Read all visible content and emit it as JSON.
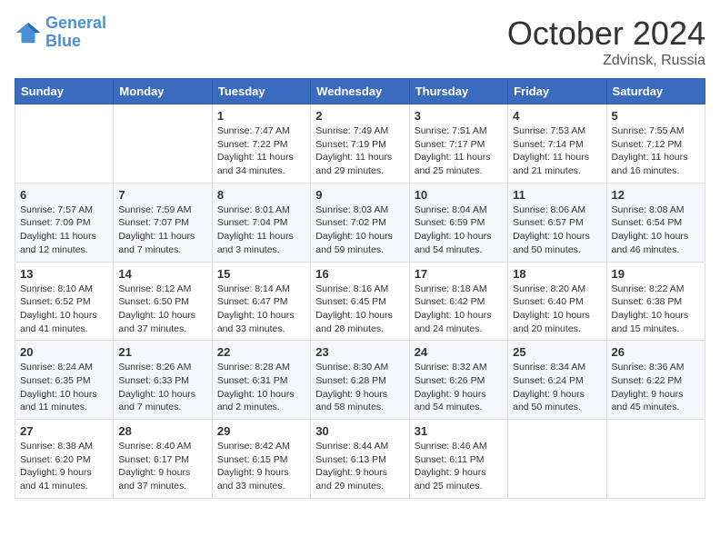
{
  "header": {
    "logo_line1": "General",
    "logo_line2": "Blue",
    "month": "October 2024",
    "location": "Zdvinsk, Russia"
  },
  "days_of_week": [
    "Sunday",
    "Monday",
    "Tuesday",
    "Wednesday",
    "Thursday",
    "Friday",
    "Saturday"
  ],
  "weeks": [
    [
      {
        "day": "",
        "info": ""
      },
      {
        "day": "",
        "info": ""
      },
      {
        "day": "1",
        "info": "Sunrise: 7:47 AM\nSunset: 7:22 PM\nDaylight: 11 hours and 34 minutes."
      },
      {
        "day": "2",
        "info": "Sunrise: 7:49 AM\nSunset: 7:19 PM\nDaylight: 11 hours and 29 minutes."
      },
      {
        "day": "3",
        "info": "Sunrise: 7:51 AM\nSunset: 7:17 PM\nDaylight: 11 hours and 25 minutes."
      },
      {
        "day": "4",
        "info": "Sunrise: 7:53 AM\nSunset: 7:14 PM\nDaylight: 11 hours and 21 minutes."
      },
      {
        "day": "5",
        "info": "Sunrise: 7:55 AM\nSunset: 7:12 PM\nDaylight: 11 hours and 16 minutes."
      }
    ],
    [
      {
        "day": "6",
        "info": "Sunrise: 7:57 AM\nSunset: 7:09 PM\nDaylight: 11 hours and 12 minutes."
      },
      {
        "day": "7",
        "info": "Sunrise: 7:59 AM\nSunset: 7:07 PM\nDaylight: 11 hours and 7 minutes."
      },
      {
        "day": "8",
        "info": "Sunrise: 8:01 AM\nSunset: 7:04 PM\nDaylight: 11 hours and 3 minutes."
      },
      {
        "day": "9",
        "info": "Sunrise: 8:03 AM\nSunset: 7:02 PM\nDaylight: 10 hours and 59 minutes."
      },
      {
        "day": "10",
        "info": "Sunrise: 8:04 AM\nSunset: 6:59 PM\nDaylight: 10 hours and 54 minutes."
      },
      {
        "day": "11",
        "info": "Sunrise: 8:06 AM\nSunset: 6:57 PM\nDaylight: 10 hours and 50 minutes."
      },
      {
        "day": "12",
        "info": "Sunrise: 8:08 AM\nSunset: 6:54 PM\nDaylight: 10 hours and 46 minutes."
      }
    ],
    [
      {
        "day": "13",
        "info": "Sunrise: 8:10 AM\nSunset: 6:52 PM\nDaylight: 10 hours and 41 minutes."
      },
      {
        "day": "14",
        "info": "Sunrise: 8:12 AM\nSunset: 6:50 PM\nDaylight: 10 hours and 37 minutes."
      },
      {
        "day": "15",
        "info": "Sunrise: 8:14 AM\nSunset: 6:47 PM\nDaylight: 10 hours and 33 minutes."
      },
      {
        "day": "16",
        "info": "Sunrise: 8:16 AM\nSunset: 6:45 PM\nDaylight: 10 hours and 28 minutes."
      },
      {
        "day": "17",
        "info": "Sunrise: 8:18 AM\nSunset: 6:42 PM\nDaylight: 10 hours and 24 minutes."
      },
      {
        "day": "18",
        "info": "Sunrise: 8:20 AM\nSunset: 6:40 PM\nDaylight: 10 hours and 20 minutes."
      },
      {
        "day": "19",
        "info": "Sunrise: 8:22 AM\nSunset: 6:38 PM\nDaylight: 10 hours and 15 minutes."
      }
    ],
    [
      {
        "day": "20",
        "info": "Sunrise: 8:24 AM\nSunset: 6:35 PM\nDaylight: 10 hours and 11 minutes."
      },
      {
        "day": "21",
        "info": "Sunrise: 8:26 AM\nSunset: 6:33 PM\nDaylight: 10 hours and 7 minutes."
      },
      {
        "day": "22",
        "info": "Sunrise: 8:28 AM\nSunset: 6:31 PM\nDaylight: 10 hours and 2 minutes."
      },
      {
        "day": "23",
        "info": "Sunrise: 8:30 AM\nSunset: 6:28 PM\nDaylight: 9 hours and 58 minutes."
      },
      {
        "day": "24",
        "info": "Sunrise: 8:32 AM\nSunset: 6:26 PM\nDaylight: 9 hours and 54 minutes."
      },
      {
        "day": "25",
        "info": "Sunrise: 8:34 AM\nSunset: 6:24 PM\nDaylight: 9 hours and 50 minutes."
      },
      {
        "day": "26",
        "info": "Sunrise: 8:36 AM\nSunset: 6:22 PM\nDaylight: 9 hours and 45 minutes."
      }
    ],
    [
      {
        "day": "27",
        "info": "Sunrise: 8:38 AM\nSunset: 6:20 PM\nDaylight: 9 hours and 41 minutes."
      },
      {
        "day": "28",
        "info": "Sunrise: 8:40 AM\nSunset: 6:17 PM\nDaylight: 9 hours and 37 minutes."
      },
      {
        "day": "29",
        "info": "Sunrise: 8:42 AM\nSunset: 6:15 PM\nDaylight: 9 hours and 33 minutes."
      },
      {
        "day": "30",
        "info": "Sunrise: 8:44 AM\nSunset: 6:13 PM\nDaylight: 9 hours and 29 minutes."
      },
      {
        "day": "31",
        "info": "Sunrise: 8:46 AM\nSunset: 6:11 PM\nDaylight: 9 hours and 25 minutes."
      },
      {
        "day": "",
        "info": ""
      },
      {
        "day": "",
        "info": ""
      }
    ]
  ]
}
